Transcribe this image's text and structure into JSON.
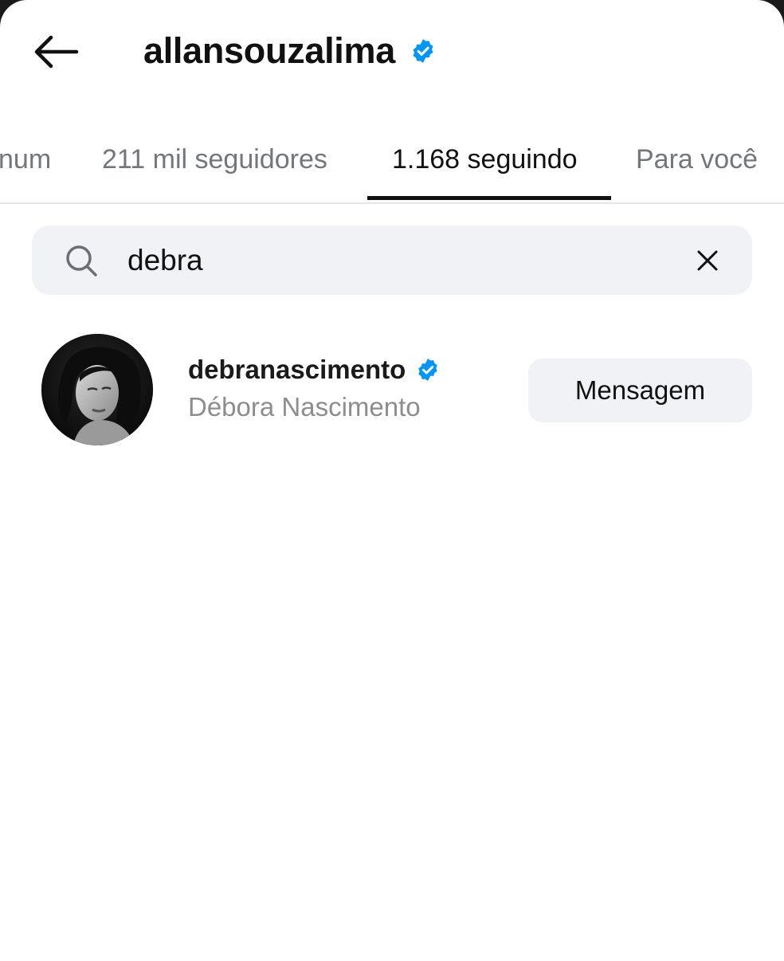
{
  "header": {
    "title": "allansouzalima",
    "verified": true
  },
  "tabs": [
    {
      "label": "num",
      "active": false
    },
    {
      "label": "211 mil seguidores",
      "active": false
    },
    {
      "label": "1.168 seguindo",
      "active": true
    },
    {
      "label": "Para você",
      "active": false
    }
  ],
  "search": {
    "value": "debra"
  },
  "results": [
    {
      "username": "debranascimento",
      "full_name": "Débora Nascimento",
      "verified": true,
      "action_label": "Mensagem"
    }
  ],
  "icons": {
    "back": "arrow-left-icon",
    "verified": "verified-badge-icon",
    "search": "search-icon",
    "clear": "close-icon"
  },
  "colors": {
    "verified_blue": "#0095f6",
    "text_primary": "#111111",
    "text_muted": "#73767a",
    "surface": "#f0f2f5"
  }
}
